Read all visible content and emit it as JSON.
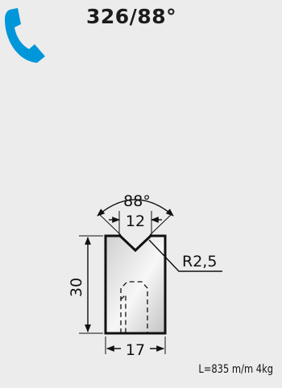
{
  "header": {
    "title": "326/88°",
    "phone_icon": "phone-handset-icon",
    "phone_color": "#0096da"
  },
  "drawing": {
    "angle_label": "88°",
    "top_width_label": "12",
    "radius_label": "R2,5",
    "height_label": "30",
    "bottom_width_label": "17"
  },
  "footer": {
    "spec": "L=835 m/m  4kg"
  },
  "colors": {
    "background": "#ececec",
    "line": "#111111",
    "accent": "#0096da"
  }
}
